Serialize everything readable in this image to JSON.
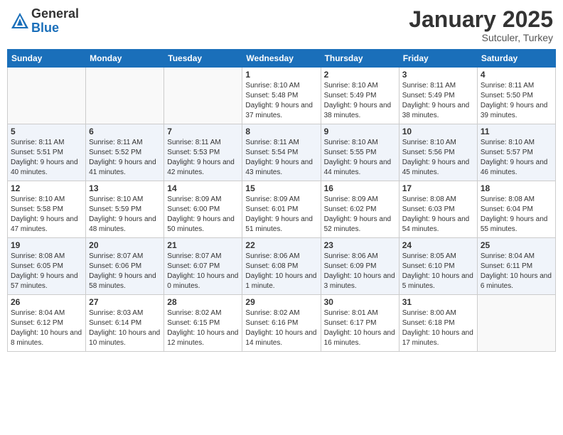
{
  "header": {
    "logo_general": "General",
    "logo_blue": "Blue",
    "month_title": "January 2025",
    "subtitle": "Sutculer, Turkey"
  },
  "weekdays": [
    "Sunday",
    "Monday",
    "Tuesday",
    "Wednesday",
    "Thursday",
    "Friday",
    "Saturday"
  ],
  "weeks": [
    {
      "alt": false,
      "days": [
        {
          "num": "",
          "info": ""
        },
        {
          "num": "",
          "info": ""
        },
        {
          "num": "",
          "info": ""
        },
        {
          "num": "1",
          "info": "Sunrise: 8:10 AM\nSunset: 5:48 PM\nDaylight: 9 hours\nand 37 minutes."
        },
        {
          "num": "2",
          "info": "Sunrise: 8:10 AM\nSunset: 5:49 PM\nDaylight: 9 hours\nand 38 minutes."
        },
        {
          "num": "3",
          "info": "Sunrise: 8:11 AM\nSunset: 5:49 PM\nDaylight: 9 hours\nand 38 minutes."
        },
        {
          "num": "4",
          "info": "Sunrise: 8:11 AM\nSunset: 5:50 PM\nDaylight: 9 hours\nand 39 minutes."
        }
      ]
    },
    {
      "alt": true,
      "days": [
        {
          "num": "5",
          "info": "Sunrise: 8:11 AM\nSunset: 5:51 PM\nDaylight: 9 hours\nand 40 minutes."
        },
        {
          "num": "6",
          "info": "Sunrise: 8:11 AM\nSunset: 5:52 PM\nDaylight: 9 hours\nand 41 minutes."
        },
        {
          "num": "7",
          "info": "Sunrise: 8:11 AM\nSunset: 5:53 PM\nDaylight: 9 hours\nand 42 minutes."
        },
        {
          "num": "8",
          "info": "Sunrise: 8:11 AM\nSunset: 5:54 PM\nDaylight: 9 hours\nand 43 minutes."
        },
        {
          "num": "9",
          "info": "Sunrise: 8:10 AM\nSunset: 5:55 PM\nDaylight: 9 hours\nand 44 minutes."
        },
        {
          "num": "10",
          "info": "Sunrise: 8:10 AM\nSunset: 5:56 PM\nDaylight: 9 hours\nand 45 minutes."
        },
        {
          "num": "11",
          "info": "Sunrise: 8:10 AM\nSunset: 5:57 PM\nDaylight: 9 hours\nand 46 minutes."
        }
      ]
    },
    {
      "alt": false,
      "days": [
        {
          "num": "12",
          "info": "Sunrise: 8:10 AM\nSunset: 5:58 PM\nDaylight: 9 hours\nand 47 minutes."
        },
        {
          "num": "13",
          "info": "Sunrise: 8:10 AM\nSunset: 5:59 PM\nDaylight: 9 hours\nand 48 minutes."
        },
        {
          "num": "14",
          "info": "Sunrise: 8:09 AM\nSunset: 6:00 PM\nDaylight: 9 hours\nand 50 minutes."
        },
        {
          "num": "15",
          "info": "Sunrise: 8:09 AM\nSunset: 6:01 PM\nDaylight: 9 hours\nand 51 minutes."
        },
        {
          "num": "16",
          "info": "Sunrise: 8:09 AM\nSunset: 6:02 PM\nDaylight: 9 hours\nand 52 minutes."
        },
        {
          "num": "17",
          "info": "Sunrise: 8:08 AM\nSunset: 6:03 PM\nDaylight: 9 hours\nand 54 minutes."
        },
        {
          "num": "18",
          "info": "Sunrise: 8:08 AM\nSunset: 6:04 PM\nDaylight: 9 hours\nand 55 minutes."
        }
      ]
    },
    {
      "alt": true,
      "days": [
        {
          "num": "19",
          "info": "Sunrise: 8:08 AM\nSunset: 6:05 PM\nDaylight: 9 hours\nand 57 minutes."
        },
        {
          "num": "20",
          "info": "Sunrise: 8:07 AM\nSunset: 6:06 PM\nDaylight: 9 hours\nand 58 minutes."
        },
        {
          "num": "21",
          "info": "Sunrise: 8:07 AM\nSunset: 6:07 PM\nDaylight: 10 hours\nand 0 minutes."
        },
        {
          "num": "22",
          "info": "Sunrise: 8:06 AM\nSunset: 6:08 PM\nDaylight: 10 hours\nand 1 minute."
        },
        {
          "num": "23",
          "info": "Sunrise: 8:06 AM\nSunset: 6:09 PM\nDaylight: 10 hours\nand 3 minutes."
        },
        {
          "num": "24",
          "info": "Sunrise: 8:05 AM\nSunset: 6:10 PM\nDaylight: 10 hours\nand 5 minutes."
        },
        {
          "num": "25",
          "info": "Sunrise: 8:04 AM\nSunset: 6:11 PM\nDaylight: 10 hours\nand 6 minutes."
        }
      ]
    },
    {
      "alt": false,
      "days": [
        {
          "num": "26",
          "info": "Sunrise: 8:04 AM\nSunset: 6:12 PM\nDaylight: 10 hours\nand 8 minutes."
        },
        {
          "num": "27",
          "info": "Sunrise: 8:03 AM\nSunset: 6:14 PM\nDaylight: 10 hours\nand 10 minutes."
        },
        {
          "num": "28",
          "info": "Sunrise: 8:02 AM\nSunset: 6:15 PM\nDaylight: 10 hours\nand 12 minutes."
        },
        {
          "num": "29",
          "info": "Sunrise: 8:02 AM\nSunset: 6:16 PM\nDaylight: 10 hours\nand 14 minutes."
        },
        {
          "num": "30",
          "info": "Sunrise: 8:01 AM\nSunset: 6:17 PM\nDaylight: 10 hours\nand 16 minutes."
        },
        {
          "num": "31",
          "info": "Sunrise: 8:00 AM\nSunset: 6:18 PM\nDaylight: 10 hours\nand 17 minutes."
        },
        {
          "num": "",
          "info": ""
        }
      ]
    }
  ]
}
